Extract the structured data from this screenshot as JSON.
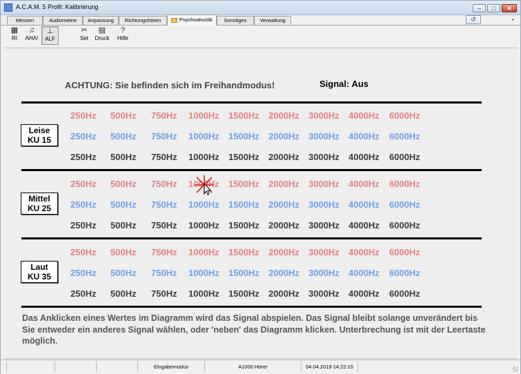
{
  "window": {
    "title": "A.C.A.M. 5  Profil: Kalibrierung",
    "controls": {
      "minimize": "–",
      "maximize": "□",
      "close": "✕"
    }
  },
  "tabs": [
    {
      "label": "Messen",
      "active": false
    },
    {
      "label": "Audiometrie",
      "active": false
    },
    {
      "label": "Anpassung",
      "active": false
    },
    {
      "label": "Richtungshören",
      "active": false
    },
    {
      "label": "Psychoakustik",
      "active": true
    },
    {
      "label": "Sonstiges",
      "active": false
    },
    {
      "label": "Verwaltung",
      "active": false
    }
  ],
  "tab_extra": {
    "help_icon": "↺",
    "dot": "•"
  },
  "toolbar": [
    {
      "label": "RI",
      "icon": "grid-icon",
      "glyph": "▦",
      "pressed": false
    },
    {
      "label": "AHA!",
      "icon": "headphones-icon",
      "glyph": "♫",
      "pressed": false
    },
    {
      "label": "ALF",
      "icon": "slider-icon",
      "glyph": "⊥",
      "pressed": true
    },
    {
      "label": "Set",
      "icon": "tools-icon",
      "glyph": "✂",
      "pressed": false
    },
    {
      "label": "Druck",
      "icon": "printer-icon",
      "glyph": "▤",
      "pressed": false
    },
    {
      "label": "Hilfe",
      "icon": "help-icon",
      "glyph": "?",
      "pressed": false
    }
  ],
  "main": {
    "warning": "ACHTUNG: Sie befinden sich im Freihandmodus!",
    "signal": "Signal: Aus",
    "frequencies": [
      "250Hz",
      "500Hz",
      "750Hz",
      "1000Hz",
      "1500Hz",
      "2000Hz",
      "3000Hz",
      "4000Hz",
      "6000Hz"
    ],
    "levels": [
      {
        "line1": "Leise",
        "line2": "KU 15"
      },
      {
        "line1": "Mittel",
        "line2": "KU 25"
      },
      {
        "line1": "Laut",
        "line2": "KU 35"
      }
    ],
    "info": "Das Anklicken eines Wertes im Diagramm wird das Signal abspielen. Das Signal bleibt solange unverändert bis Sie entweder ein anderes Signal wählen, oder 'neben' das Diagramm klicken. Unterbrechung ist mit der Leertaste möglich."
  },
  "statusbar": {
    "mode": "Eingabemodus",
    "device": "A1000 Hörer",
    "datetime": "04.04.2019 14:22:15"
  },
  "colors": {
    "red": "#e98080",
    "blue": "#6fa0ec",
    "black": "#3c3c3c"
  }
}
